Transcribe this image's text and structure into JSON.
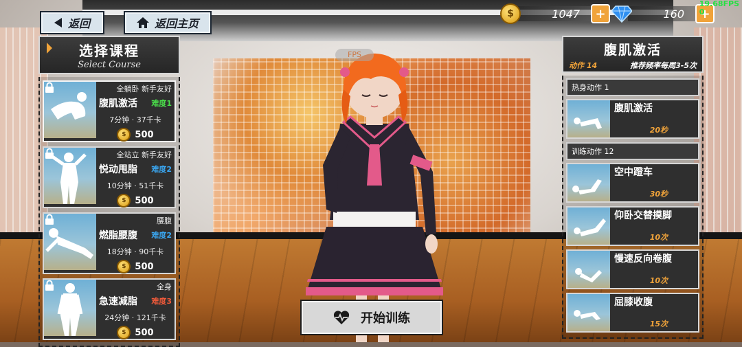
{
  "nav": {
    "back_label": "返回",
    "home_label": "返回主页"
  },
  "currency": {
    "coins": "1047",
    "gems": "160"
  },
  "fps": {
    "value": "19.68FPS",
    "count": "0"
  },
  "left_panel": {
    "title": "选择课程",
    "subtitle": "Select Course",
    "courses": [
      {
        "tags": "全躺卧 新手友好",
        "name": "腹肌激活",
        "difficulty": "难度1",
        "difficulty_color": "#4ae04a",
        "meta": "7分钟 · 37千卡",
        "price": "500"
      },
      {
        "tags": "全站立 新手友好",
        "name": "悦动甩脂",
        "difficulty": "难度2",
        "difficulty_color": "#3aa6f0",
        "meta": "10分钟 · 51千卡",
        "price": "500"
      },
      {
        "tags": "腰腹",
        "name": "燃脂腰腹",
        "difficulty": "难度2",
        "difficulty_color": "#3aa6f0",
        "meta": "18分钟 · 90千卡",
        "price": "500"
      },
      {
        "tags": "全身",
        "name": "急速减脂",
        "difficulty": "难度3",
        "difficulty_color": "#f05a3a",
        "meta": "24分钟 · 121千卡",
        "price": "500"
      }
    ]
  },
  "right_panel": {
    "title": "腹肌激活",
    "action_count": "动作 14",
    "frequency": "推荐频率每周3-5次",
    "warmup_label": "热身动作 1",
    "training_label": "训练动作 12",
    "warmup": [
      {
        "name": "腹肌激活",
        "duration": "20秒"
      }
    ],
    "training": [
      {
        "name": "空中蹬车",
        "duration": "30秒"
      },
      {
        "name": "仰卧交替摸脚",
        "duration": "10次"
      },
      {
        "name": "慢速反向卷腹",
        "duration": "10次"
      },
      {
        "name": "屈膝收腹",
        "duration": "15次"
      }
    ]
  },
  "start_button": {
    "label": "开始训练"
  },
  "icons": {
    "back": "back-arrow-icon",
    "home": "home-icon",
    "lock": "lock-icon",
    "heartbeat": "heartbeat-icon",
    "coin": "coin-icon",
    "gem": "diamond-icon"
  }
}
